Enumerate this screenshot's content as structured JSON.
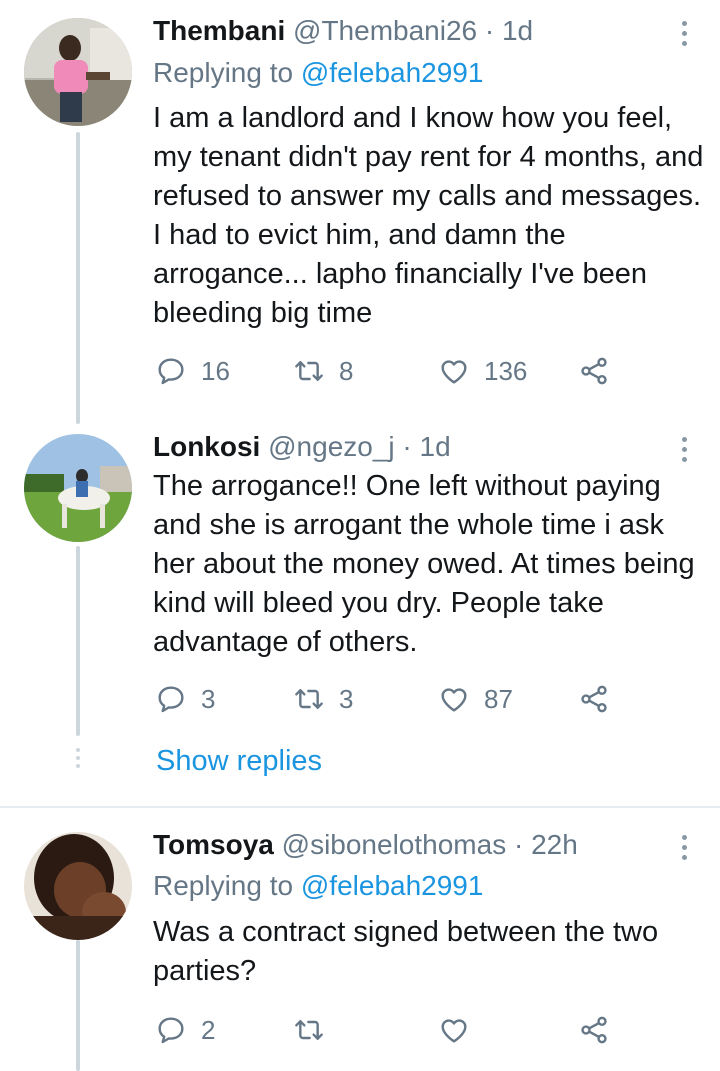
{
  "tweets": [
    {
      "name": "Thembani",
      "handle": "@Thembani26",
      "sep": "·",
      "time": "1d",
      "replying_prefix": "Replying to ",
      "replying_to": "@felebah2991",
      "text": "I am a landlord and I know how you feel, my tenant didn't pay rent for 4 months, and refused to answer my calls and messages. I had to evict him, and damn the arrogance... lapho financially I've been bleeding big time",
      "replies": "16",
      "retweets": "8",
      "likes": "136"
    },
    {
      "name": "Lonkosi",
      "handle": "@ngezo_j",
      "sep": "·",
      "time": "1d",
      "text": "The arrogance!! One left without paying and she is arrogant the whole time i ask her about the money owed. At times being kind will bleed you dry. People take advantage of others.",
      "replies": "3",
      "retweets": "3",
      "likes": "87"
    },
    {
      "name": "Tomsoya",
      "handle": "@sibonelothomas",
      "sep": "·",
      "time": "22h",
      "replying_prefix": "Replying to ",
      "replying_to": "@felebah2991",
      "text": "Was a contract signed between the two parties?",
      "replies": "2",
      "retweets": "",
      "likes": ""
    }
  ],
  "show_replies": "Show replies",
  "icons": {
    "reply": "reply-icon",
    "retweet": "retweet-icon",
    "like": "heart-icon",
    "share": "share-icon",
    "more": "more-vertical-icon"
  },
  "colors": {
    "link": "#1b95e0",
    "muted": "#657786",
    "thread_line": "#ccd6dd",
    "divider": "#e6ecf0"
  }
}
